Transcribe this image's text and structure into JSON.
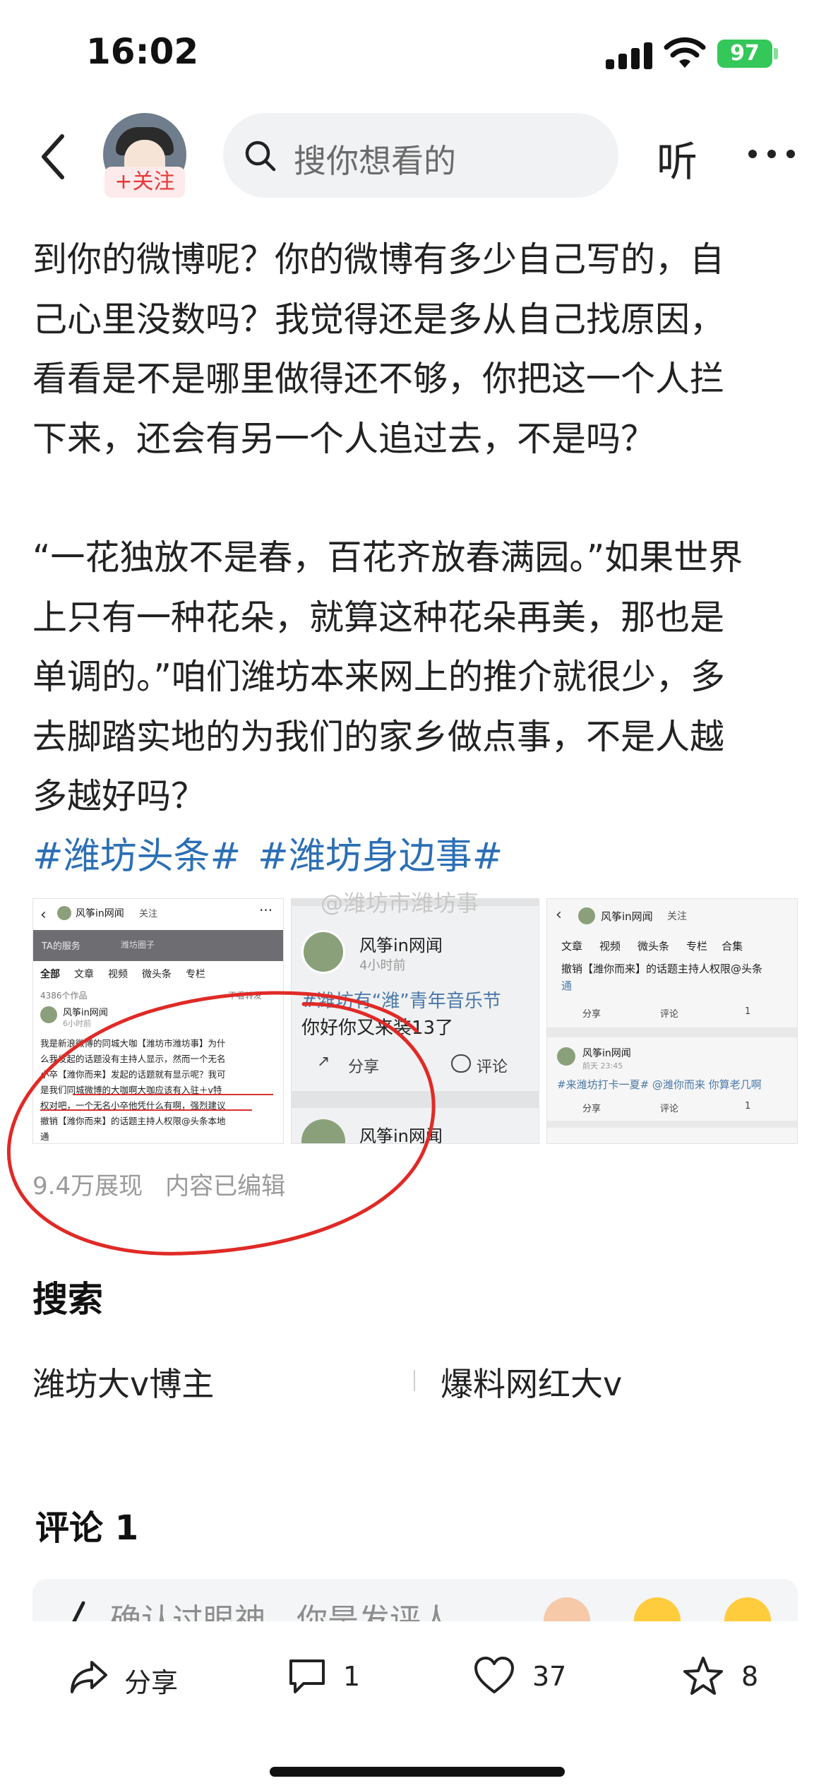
{
  "status_bar": {
    "time": "16:02",
    "battery": "97"
  },
  "header": {
    "follow_label": "+关注",
    "search_placeholder": "搜你想看的",
    "listen_label": "听"
  },
  "article": {
    "lines_p1": [
      "到你的微博呢？你的微博有多少自己写的，自",
      "己心里没数吗？我觉得还是多从自己找原因，",
      "看看是不是哪里做得还不够，你把这一个人拦",
      "下来，还会有另一个人追过去，不是吗？"
    ],
    "lines_p2": [
      "“一花独放不是春，百花齐放春满园。”如果世界",
      "上只有一种花朵，就算这种花朵再美，那也是",
      "单调的。”咱们潍坊本来网上的推介就很少，多",
      "去脚踏实地的为我们的家乡做点事，不是人越",
      "多越好吗？"
    ],
    "hashtags": [
      "#潍坊头条#",
      "#潍坊身边事#"
    ]
  },
  "images": {
    "watermark": "@潍坊市潍坊事",
    "img1": {
      "account": "风筝in网闻",
      "follow": "关注",
      "service": "TA的服务",
      "circle": "潍坊圈子",
      "tabs": [
        "全部",
        "文章",
        "视频",
        "微头条",
        "专栏"
      ],
      "count": "4386个作品",
      "no_repost": "不看转发",
      "post_author": "风筝in网闻",
      "post_time": "6小时前",
      "post_text": [
        "我是新浪微博的同城大咖【潍坊市潍坊事】为什",
        "么我发起的话题没有主持人显示，然而一个无名",
        "小卒【潍你而来】发起的话题就有显示呢？我可",
        "是我们同城微博的大咖啊大咖应该有入驻＋v特",
        "权对吧，一个无名小卒他凭什么有啊，强烈建议",
        "撤销【潍你而来】的话题主持人权限@头条本地",
        "通"
      ]
    },
    "img2": {
      "author": "风筝in网闻",
      "time": "4小时前",
      "title": "#潍坊有“潍”青年音乐节",
      "text": "你好你又来装13了",
      "share": "分享",
      "comment": "评论",
      "author2": "风筝in网闻"
    },
    "img3": {
      "account": "风筝in网闻",
      "follow": "关注",
      "tabs": [
        "文章",
        "视频",
        "微头条",
        "专栏",
        "合集"
      ],
      "line1": "撤销【潍你而来】的话题主持人权限@头条",
      "line2": "通",
      "share": "分享",
      "comment": "评论",
      "likes": "1",
      "author2": "风筝in网闻",
      "time2": "前天 23:45",
      "post2": "#来潍坊打卡一夏# @潍你而来 你算老几啊",
      "likes2": "1"
    }
  },
  "stats": {
    "views": "9.4万展现",
    "edited": "内容已编辑"
  },
  "search_section": {
    "title": "搜索",
    "tags": [
      "潍坊大v博主",
      "爆料网红大v"
    ]
  },
  "comments": {
    "title": "评论 1",
    "placeholder": "确认过眼神，你是发评人"
  },
  "bottom_bar": {
    "share": "分享",
    "comments": "1",
    "likes": "37",
    "favorites": "8"
  }
}
